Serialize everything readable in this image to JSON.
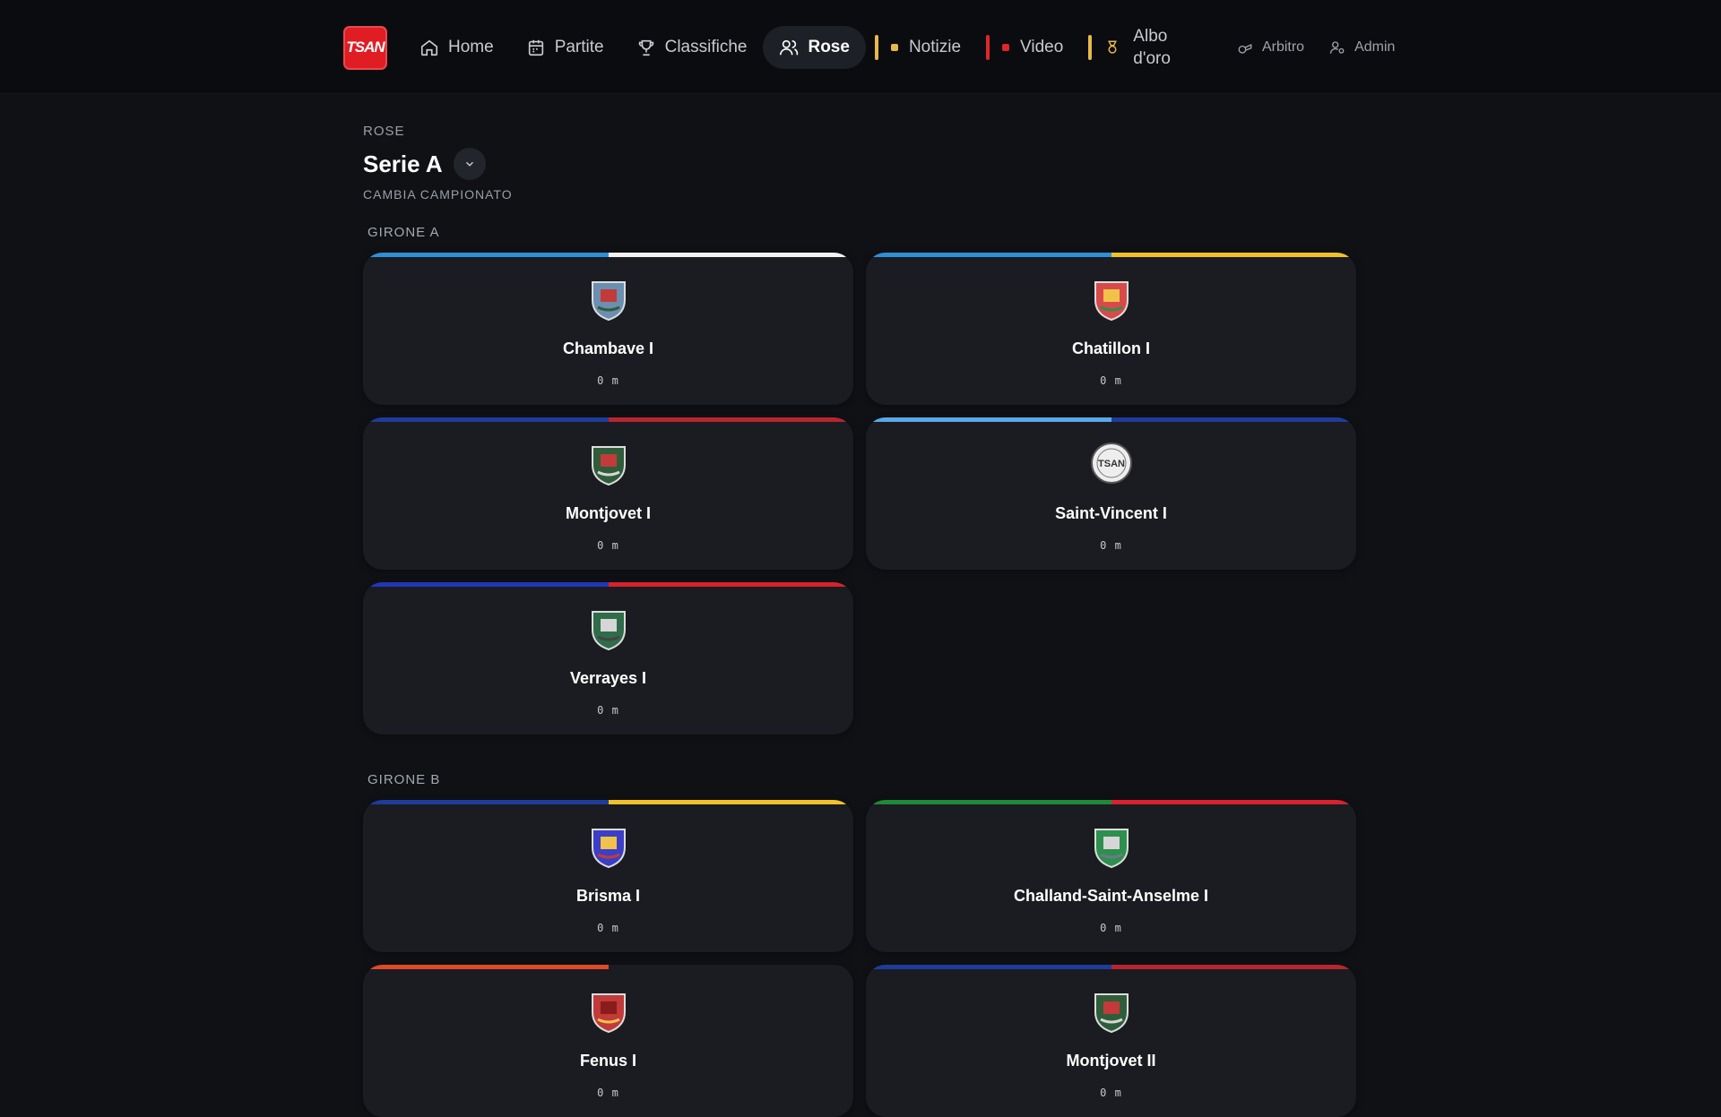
{
  "nav": {
    "logo_text": "TSAN",
    "items": [
      {
        "label": "Home",
        "icon": "home-icon"
      },
      {
        "label": "Partite",
        "icon": "calendar-icon"
      },
      {
        "label": "Classifiche",
        "icon": "trophy-icon"
      },
      {
        "label": "Rose",
        "icon": "users-icon",
        "active": true
      }
    ],
    "section_links": [
      {
        "label": "Notizie",
        "accent": "#e7b84a"
      },
      {
        "label": "Video",
        "accent": "#e0252b"
      },
      {
        "label": "Albo d'oro",
        "label_line1": "Albo",
        "label_line2": "d'oro",
        "accent": "#e7b84a"
      }
    ],
    "utility": [
      {
        "label": "Arbitro",
        "icon": "whistle-icon"
      },
      {
        "label": "Admin",
        "icon": "user-gear-icon"
      }
    ]
  },
  "page": {
    "eyebrow": "ROSE",
    "title": "Serie A",
    "subtitle": "CAMBIA CAMPIONATO"
  },
  "groups": [
    {
      "label": "GIRONE A",
      "teams": [
        {
          "name": "Chambave I",
          "meta": "0 m",
          "colors": [
            "#2f8fd6",
            "#f2f2f2"
          ]
        },
        {
          "name": "Chatillon I",
          "meta": "0 m",
          "colors": [
            "#2f8fd6",
            "#f2c12a"
          ]
        },
        {
          "name": "Montjovet I",
          "meta": "0 m",
          "colors": [
            "#1f3c9a",
            "#b8252f"
          ]
        },
        {
          "name": "Saint-Vincent I",
          "meta": "0 m",
          "colors": [
            "#5aa8e6",
            "#1f3c9a"
          ]
        },
        {
          "name": "Verrayes I",
          "meta": "0 m",
          "colors": [
            "#2236b8",
            "#d8222d"
          ]
        }
      ]
    },
    {
      "label": "GIRONE B",
      "teams": [
        {
          "name": "Brisma I",
          "meta": "0 m",
          "colors": [
            "#1f3c9a",
            "#f2c12a"
          ]
        },
        {
          "name": "Challand-Saint-Anselme I",
          "meta": "0 m",
          "colors": [
            "#1f8a3a",
            "#d8222d"
          ]
        },
        {
          "name": "Fenus I",
          "meta": "0 m",
          "colors": [
            "#e0492a",
            "#1a1c21"
          ]
        },
        {
          "name": "Montjovet II",
          "meta": "0 m",
          "colors": [
            "#1f3c9a",
            "#b8252f"
          ]
        }
      ]
    }
  ]
}
